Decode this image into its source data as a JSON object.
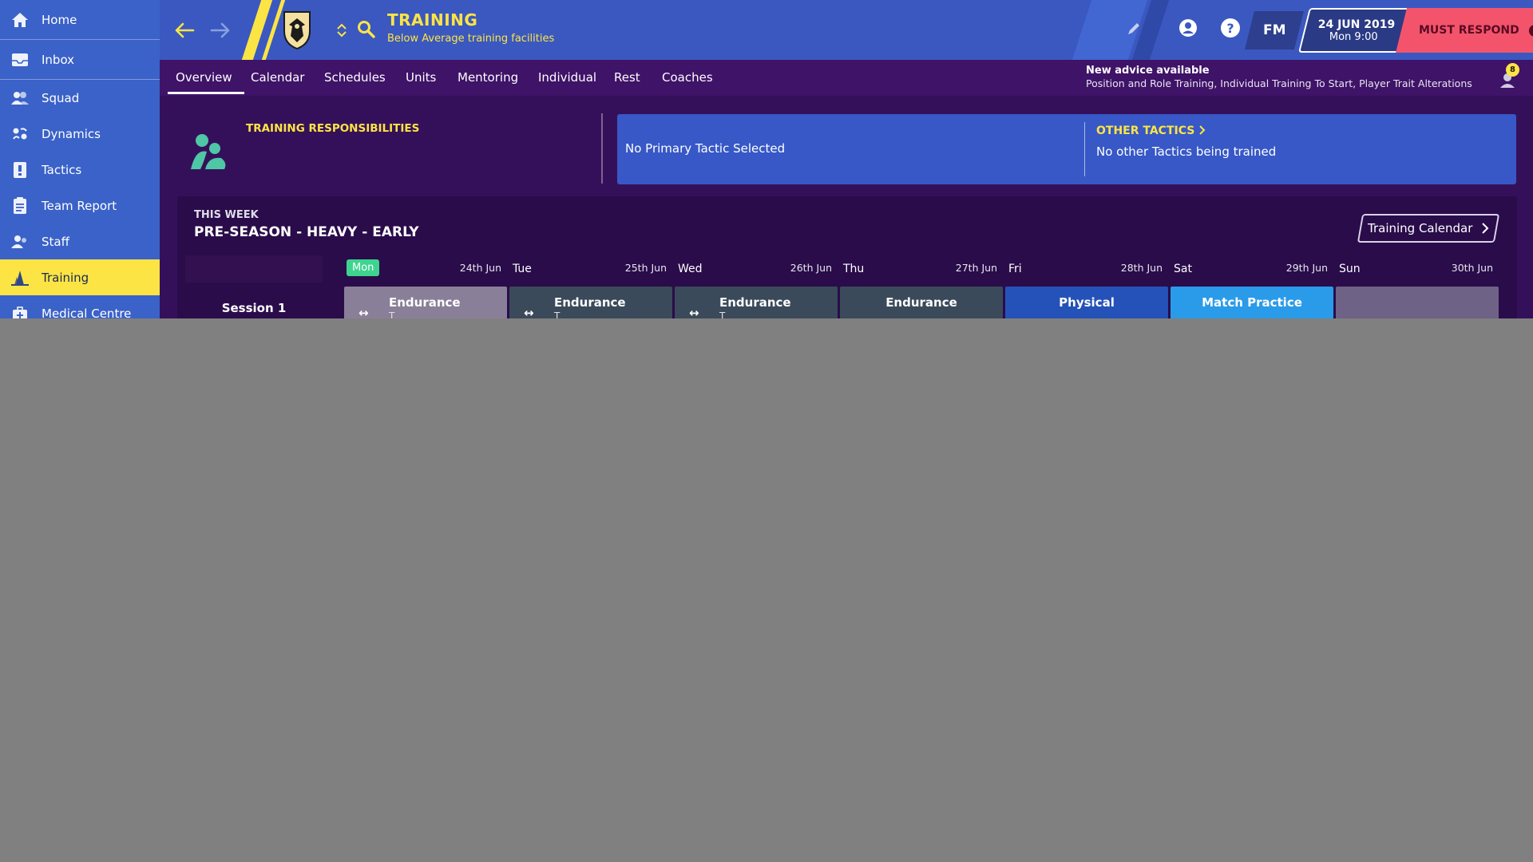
{
  "sidebar": {
    "items": [
      {
        "label": "Home",
        "icon": "home-icon"
      },
      {
        "label": "Inbox",
        "icon": "inbox-icon"
      },
      {
        "label": "Squad",
        "icon": "squad-icon"
      },
      {
        "label": "Dynamics",
        "icon": "dynamics-icon"
      },
      {
        "label": "Tactics",
        "icon": "tactics-icon"
      },
      {
        "label": "Team Report",
        "icon": "report-icon"
      },
      {
        "label": "Staff",
        "icon": "staff-icon"
      },
      {
        "label": "Training",
        "icon": "training-icon",
        "active": true
      },
      {
        "label": "Medical Centre",
        "icon": "medical-icon"
      }
    ]
  },
  "header": {
    "title": "TRAINING",
    "subtitle": "Below Average training facilities",
    "fm_label": "FM",
    "date": "24 JUN 2019",
    "time": "Mon 9:00",
    "must_respond": "MUST RESPOND",
    "must_icon": "!"
  },
  "tabs": [
    {
      "label": "Overview",
      "active": true
    },
    {
      "label": "Calendar"
    },
    {
      "label": "Schedules"
    },
    {
      "label": "Units"
    },
    {
      "label": "Mentoring"
    },
    {
      "label": "Individual"
    },
    {
      "label": "Rest"
    },
    {
      "label": "Coaches"
    }
  ],
  "advice": {
    "title": "New advice available",
    "text": "Position and Role Training, Individual Training To Start, Player Trait Alterations",
    "count": "8"
  },
  "responsibilities": {
    "title": "TRAINING RESPONSIBILITIES"
  },
  "tactics": {
    "primary": "No Primary Tactic Selected",
    "other_title": "OTHER TACTICS",
    "other_text": "No other Tactics being trained"
  },
  "week": {
    "label": "THIS WEEK",
    "title": "PRE-SEASON - HEAVY - EARLY",
    "calendar_button": "Training Calendar",
    "days": [
      {
        "name": "Mon",
        "date": "24th Jun",
        "today": true
      },
      {
        "name": "Tue",
        "date": "25th Jun"
      },
      {
        "name": "Wed",
        "date": "26th Jun"
      },
      {
        "name": "Thu",
        "date": "27th Jun"
      },
      {
        "name": "Fri",
        "date": "28th Jun"
      },
      {
        "name": "Sat",
        "date": "29th Jun"
      },
      {
        "name": "Sun",
        "date": "30th Jun"
      }
    ],
    "session_label": "Session 1",
    "sessions": [
      {
        "label": "Endurance",
        "sub": "T",
        "color": "#8a7f98",
        "icon": "↔"
      },
      {
        "label": "Endurance",
        "sub": "T",
        "color": "#3a4a5a",
        "icon": "↔"
      },
      {
        "label": "Endurance",
        "sub": "T",
        "color": "#3a4a5a",
        "icon": "↔"
      },
      {
        "label": "Endurance",
        "sub": "",
        "color": "#3a4a5a",
        "icon": ""
      },
      {
        "label": "Physical",
        "sub": "",
        "color": "#2552b8",
        "icon": ""
      },
      {
        "label": "Match Practice",
        "sub": "",
        "color": "#2a9be8",
        "icon": ""
      },
      {
        "label": "",
        "sub": "",
        "color": "#6e6286",
        "icon": ""
      }
    ]
  },
  "colors": {
    "accent": "#fde445",
    "sidebar": "#3a62c8",
    "topbar": "#3a58c0",
    "content_bg": "#35105a",
    "must_respond": "#f3546c",
    "today_badge": "#3ed48f"
  }
}
